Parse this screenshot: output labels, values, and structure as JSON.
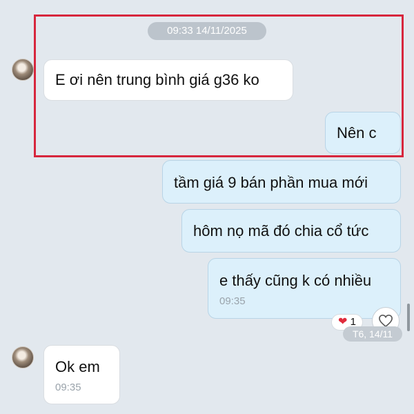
{
  "chat": {
    "date_separator": "09:33 14/11/2025",
    "messages": [
      {
        "side": "in",
        "text": "E ơi nên trung bình giá g36 ko"
      },
      {
        "side": "out",
        "text": "Nên c"
      },
      {
        "side": "out",
        "text": "tầm giá 9 bán phần mua mới"
      },
      {
        "side": "out",
        "text": "hôm nọ mã đó chia cổ tức"
      },
      {
        "side": "out",
        "text": "e thấy cũng k có nhiều",
        "time": "09:35"
      },
      {
        "side": "in",
        "text": "Ok em",
        "time": "09:35"
      }
    ],
    "reaction": {
      "icon": "heart-icon",
      "count": "1"
    },
    "react_button_icon": "heart-outline-icon",
    "scroll_date": "T6, 14/11"
  },
  "colors": {
    "highlight_border": "#d7263d",
    "background": "#e2e8ee",
    "incoming_bubble": "#ffffff",
    "outgoing_bubble": "#dcf0fb",
    "reaction_heart": "#e02b3b"
  }
}
